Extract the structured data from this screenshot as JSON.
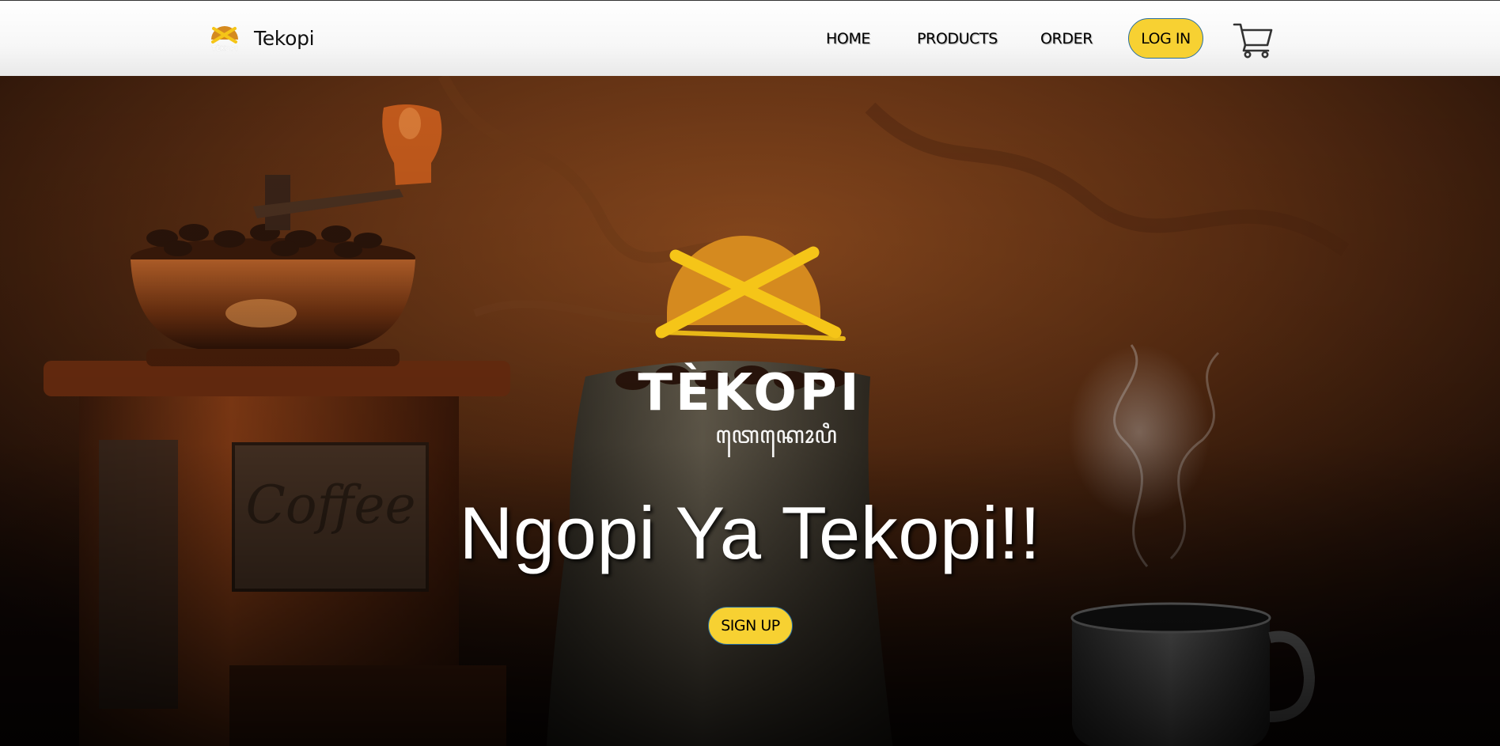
{
  "navbar": {
    "brand_name": "Tekopi",
    "brand_logo_icon": "tekopi-logo-icon",
    "links": [
      {
        "label": "HOME"
      },
      {
        "label": "PRODUCTS"
      },
      {
        "label": "ORDER"
      }
    ],
    "login_label": "LOG IN",
    "cart_icon": "shopping-cart-icon"
  },
  "hero": {
    "logo_wordmark": "TÈKOPI",
    "logo_script": "ꦠꦺꦏꦺꦴꦥꦶ",
    "title": "Ngopi Ya Tekopi!!",
    "signup_label": "SIGN UP",
    "background_image": "coffee-grinder-beans-sack-cup-photo"
  },
  "colors": {
    "button_yellow": "#f7d132",
    "button_border": "#2a6fa0",
    "logo_orange": "#d58a1f",
    "logo_yellow": "#f5c518"
  }
}
